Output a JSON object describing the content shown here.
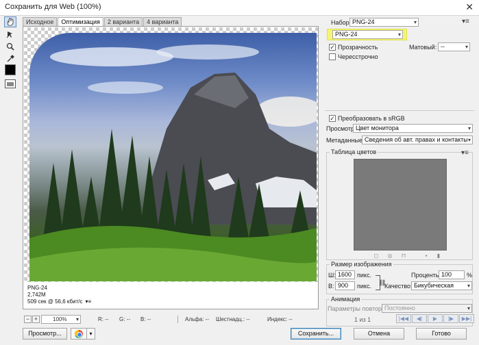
{
  "window": {
    "title": "Сохранить для Web (100%)",
    "close_glyph": "✕"
  },
  "tabs": [
    "Исходное",
    "Оптимизация",
    "2 варианта",
    "4 варианта"
  ],
  "tools": [
    "hand-icon",
    "slice-select-icon",
    "zoom-icon",
    "eyedropper-icon"
  ],
  "colors": {
    "highlight": "#f5f573",
    "accent": "#3c7fb1"
  },
  "image_info": {
    "format": "PNG-24",
    "size": "2,742M",
    "timing": "509 сек @ 56,6 кбит/с",
    "timing_menu": "▾≡"
  },
  "statusbar": {
    "zoom": "100%",
    "r": "R: --",
    "g": "G: --",
    "b": "B: --",
    "alpha": "Альфа: --",
    "hex": "Шестнадц.: --",
    "index": "Индекс: --"
  },
  "buttons": {
    "preview": "Просмотр...",
    "save": "Сохранить...",
    "cancel": "Отмена",
    "done": "Готово"
  },
  "settings": {
    "preset_label": "Набор:",
    "preset_value": "PNG-24",
    "format_value": "PNG-24",
    "transparency": "Прозрачность",
    "matte_label": "Матовый:",
    "matte_value": "--",
    "interlaced": "Чересстрочно",
    "convert_srgb": "Преобразовать в sRGB",
    "preview_label": "Просмотр:",
    "preview_value": "Цвет монитора",
    "metadata_label": "Метаданные:",
    "metadata_value": "Сведения об авт. правах и контакты"
  },
  "color_table": {
    "title": "Таблица цветов"
  },
  "image_size": {
    "title": "Размер изображения",
    "w_label": "Ш:",
    "w_value": "1600",
    "w_unit": "пикс.",
    "h_label": "В:",
    "h_value": "900",
    "h_unit": "пикс.",
    "percent_label": "Проценты:",
    "percent_value": "100",
    "percent_unit": "%",
    "quality_label": "Качество:",
    "quality_value": "Бикубическая"
  },
  "animation": {
    "title": "Анимация",
    "repeat_label": "Параметры повторов:",
    "repeat_value": "Постоянно",
    "frame_counter": "1 из 1"
  }
}
